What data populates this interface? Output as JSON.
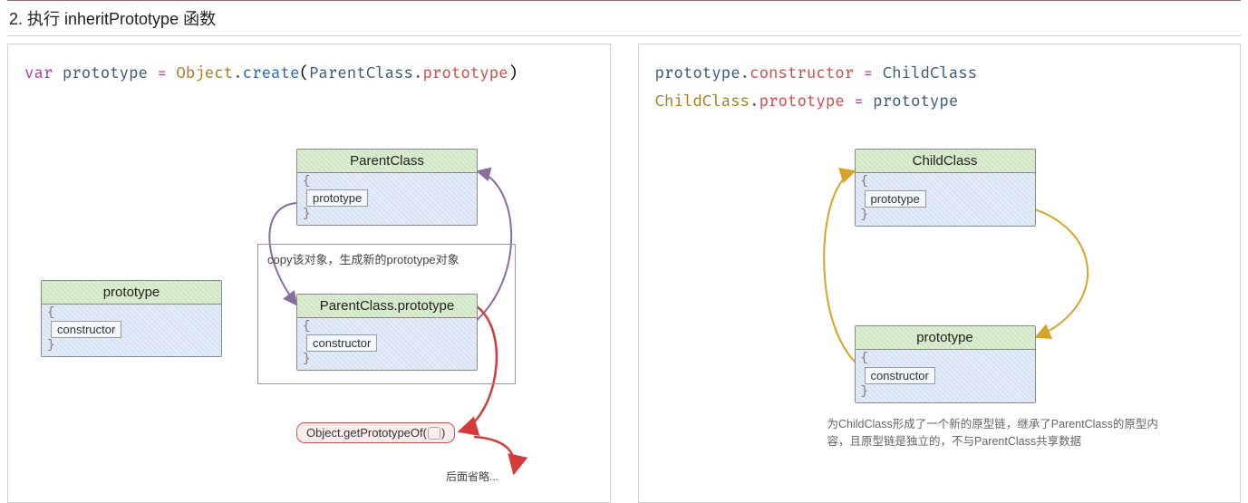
{
  "title": "2. 执行 inheritPrototype 函数",
  "left": {
    "code": {
      "var": "var",
      "id": "prototype",
      "eq": "=",
      "obj": "Object",
      "dot1": ".",
      "fn": "create",
      "open": "(",
      "cls": "ParentClass",
      "dot2": ".",
      "proto": "prototype",
      "close": ")"
    },
    "boxes": {
      "prototype": {
        "title": "prototype",
        "slot": "constructor"
      },
      "parentClass": {
        "title": "ParentClass",
        "slot": "prototype"
      },
      "parentProto": {
        "title": "ParentClass.prototype",
        "slot": "constructor"
      }
    },
    "copyNote": "copy该对象，生成新的prototype对象",
    "callPill": "Object.getPrototypeOf(",
    "pillClose": ")",
    "ellipsisNote": "后面省略..."
  },
  "right": {
    "codeLines": {
      "l1": {
        "id": "prototype",
        "dot1": ".",
        "constructor": "constructor",
        "eq": "=",
        "rhs": "ChildClass"
      },
      "l2": {
        "cls": "ChildClass",
        "dot1": ".",
        "proto": "prototype",
        "eq": "=",
        "rhs": "prototype"
      }
    },
    "boxes": {
      "childClass": {
        "title": "ChildClass",
        "slot": "prototype"
      },
      "prototype": {
        "title": "prototype",
        "slot": "constructor"
      }
    },
    "note": "为ChildClass形成了一个新的原型链，继承了ParentClass的原型内容，且原型链是独立的，不与ParentClass共享数据"
  }
}
